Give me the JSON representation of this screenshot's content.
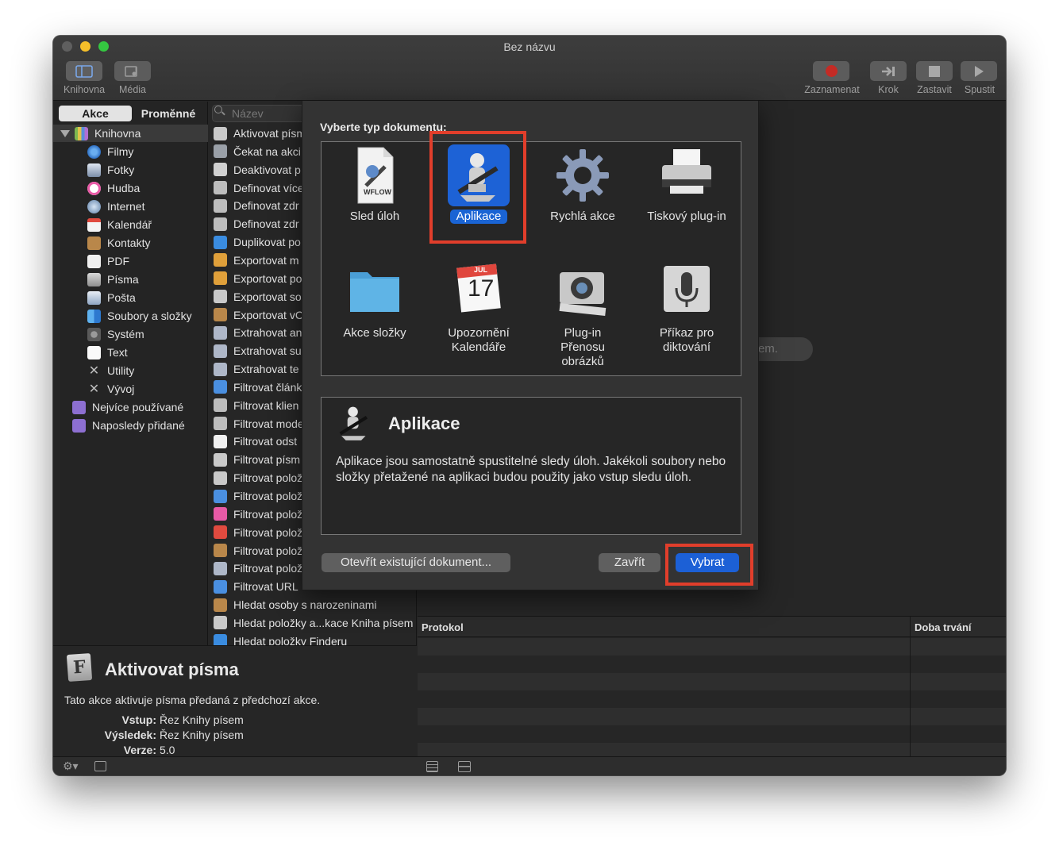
{
  "window": {
    "title": "Bez názvu"
  },
  "toolbar": {
    "left": [
      {
        "label": "Knihovna",
        "icon": "library-icon"
      },
      {
        "label": "Média",
        "icon": "media-icon"
      }
    ],
    "right": [
      {
        "label": "Zaznamenat",
        "icon": "record-icon"
      },
      {
        "label": "Krok",
        "icon": "step-icon"
      },
      {
        "label": "Zastavit",
        "icon": "stop-icon"
      },
      {
        "label": "Spustit",
        "icon": "run-icon"
      }
    ]
  },
  "library": {
    "segments": [
      "Akce",
      "Proměnné"
    ],
    "search_placeholder": "Název",
    "root": "Knihovna",
    "items": [
      "Filmy",
      "Fotky",
      "Hudba",
      "Internet",
      "Kalendář",
      "Kontakty",
      "PDF",
      "Písma",
      "Pošta",
      "Soubory a složky",
      "Systém",
      "Text",
      "Utility",
      "Vývoj"
    ],
    "extra": [
      "Nejvíce používané",
      "Naposledy přidané"
    ]
  },
  "actions": [
    "Aktivovat písma",
    "Čekat na akci",
    "Deaktivovat p",
    "Definovat více",
    "Definovat zdr",
    "Definovat zdr",
    "Duplikovat po",
    "Exportovat m",
    "Exportovat po",
    "Exportovat so",
    "Exportovat vC",
    "Extrahovat an",
    "Extrahovat su",
    "Extrahovat te",
    "Filtrovat článk",
    "Filtrovat klien",
    "Filtrovat mode",
    "Filtrovat odst",
    "Filtrovat písm",
    "Filtrovat polož",
    "Filtrovat polož",
    "Filtrovat polož",
    "Filtrovat polož",
    "Filtrovat polož",
    "Filtrovat polož",
    "Filtrovat URL",
    "Hledat osoby s narozeninami",
    "Hledat položky a...kace Kniha písem",
    "Hledat položky Finderu"
  ],
  "workflow": {
    "drop_hint": "Přetáhněte akce sem."
  },
  "log": {
    "col_protocol": "Protokol",
    "col_duration": "Doba trvání"
  },
  "description": {
    "title": "Aktivovat písma",
    "text": "Tato akce aktivuje písma předaná z předchozí akce.",
    "input_label": "Vstup:",
    "input_value": "Řez Knihy písem",
    "result_label": "Výsledek:",
    "result_value": "Řez Knihy písem",
    "version_label": "Verze:",
    "version_value": "5.0"
  },
  "sheet": {
    "heading": "Vyberte typ dokumentu:",
    "types": [
      {
        "label": "Sled úloh",
        "icon": "workflow-file-icon",
        "badge": "WFLOW"
      },
      {
        "label": "Aplikace",
        "icon": "automator-robot-icon",
        "selected": true
      },
      {
        "label": "Rychlá akce",
        "icon": "gear-icon"
      },
      {
        "label": "Tiskový plug-in",
        "icon": "printer-icon"
      },
      {
        "label": "Akce složky",
        "icon": "folder-icon"
      },
      {
        "label": "Upozornění Kalendáře",
        "icon": "calendar-icon",
        "cal_month": "JUL",
        "cal_day": "17"
      },
      {
        "label": "Plug-in Přenosu obrázků",
        "icon": "image-capture-icon"
      },
      {
        "label": "Příkaz pro diktování",
        "icon": "microphone-icon"
      }
    ],
    "detail_title": "Aplikace",
    "detail_text": "Aplikace jsou samostatně spustitelné sledy úloh. Jakékoli soubory nebo složky přetažené na aplikaci budou použity jako vstup sledu úloh.",
    "btn_open": "Otevřít existující dokument...",
    "btn_close": "Zavřít",
    "btn_choose": "Vybrat"
  }
}
